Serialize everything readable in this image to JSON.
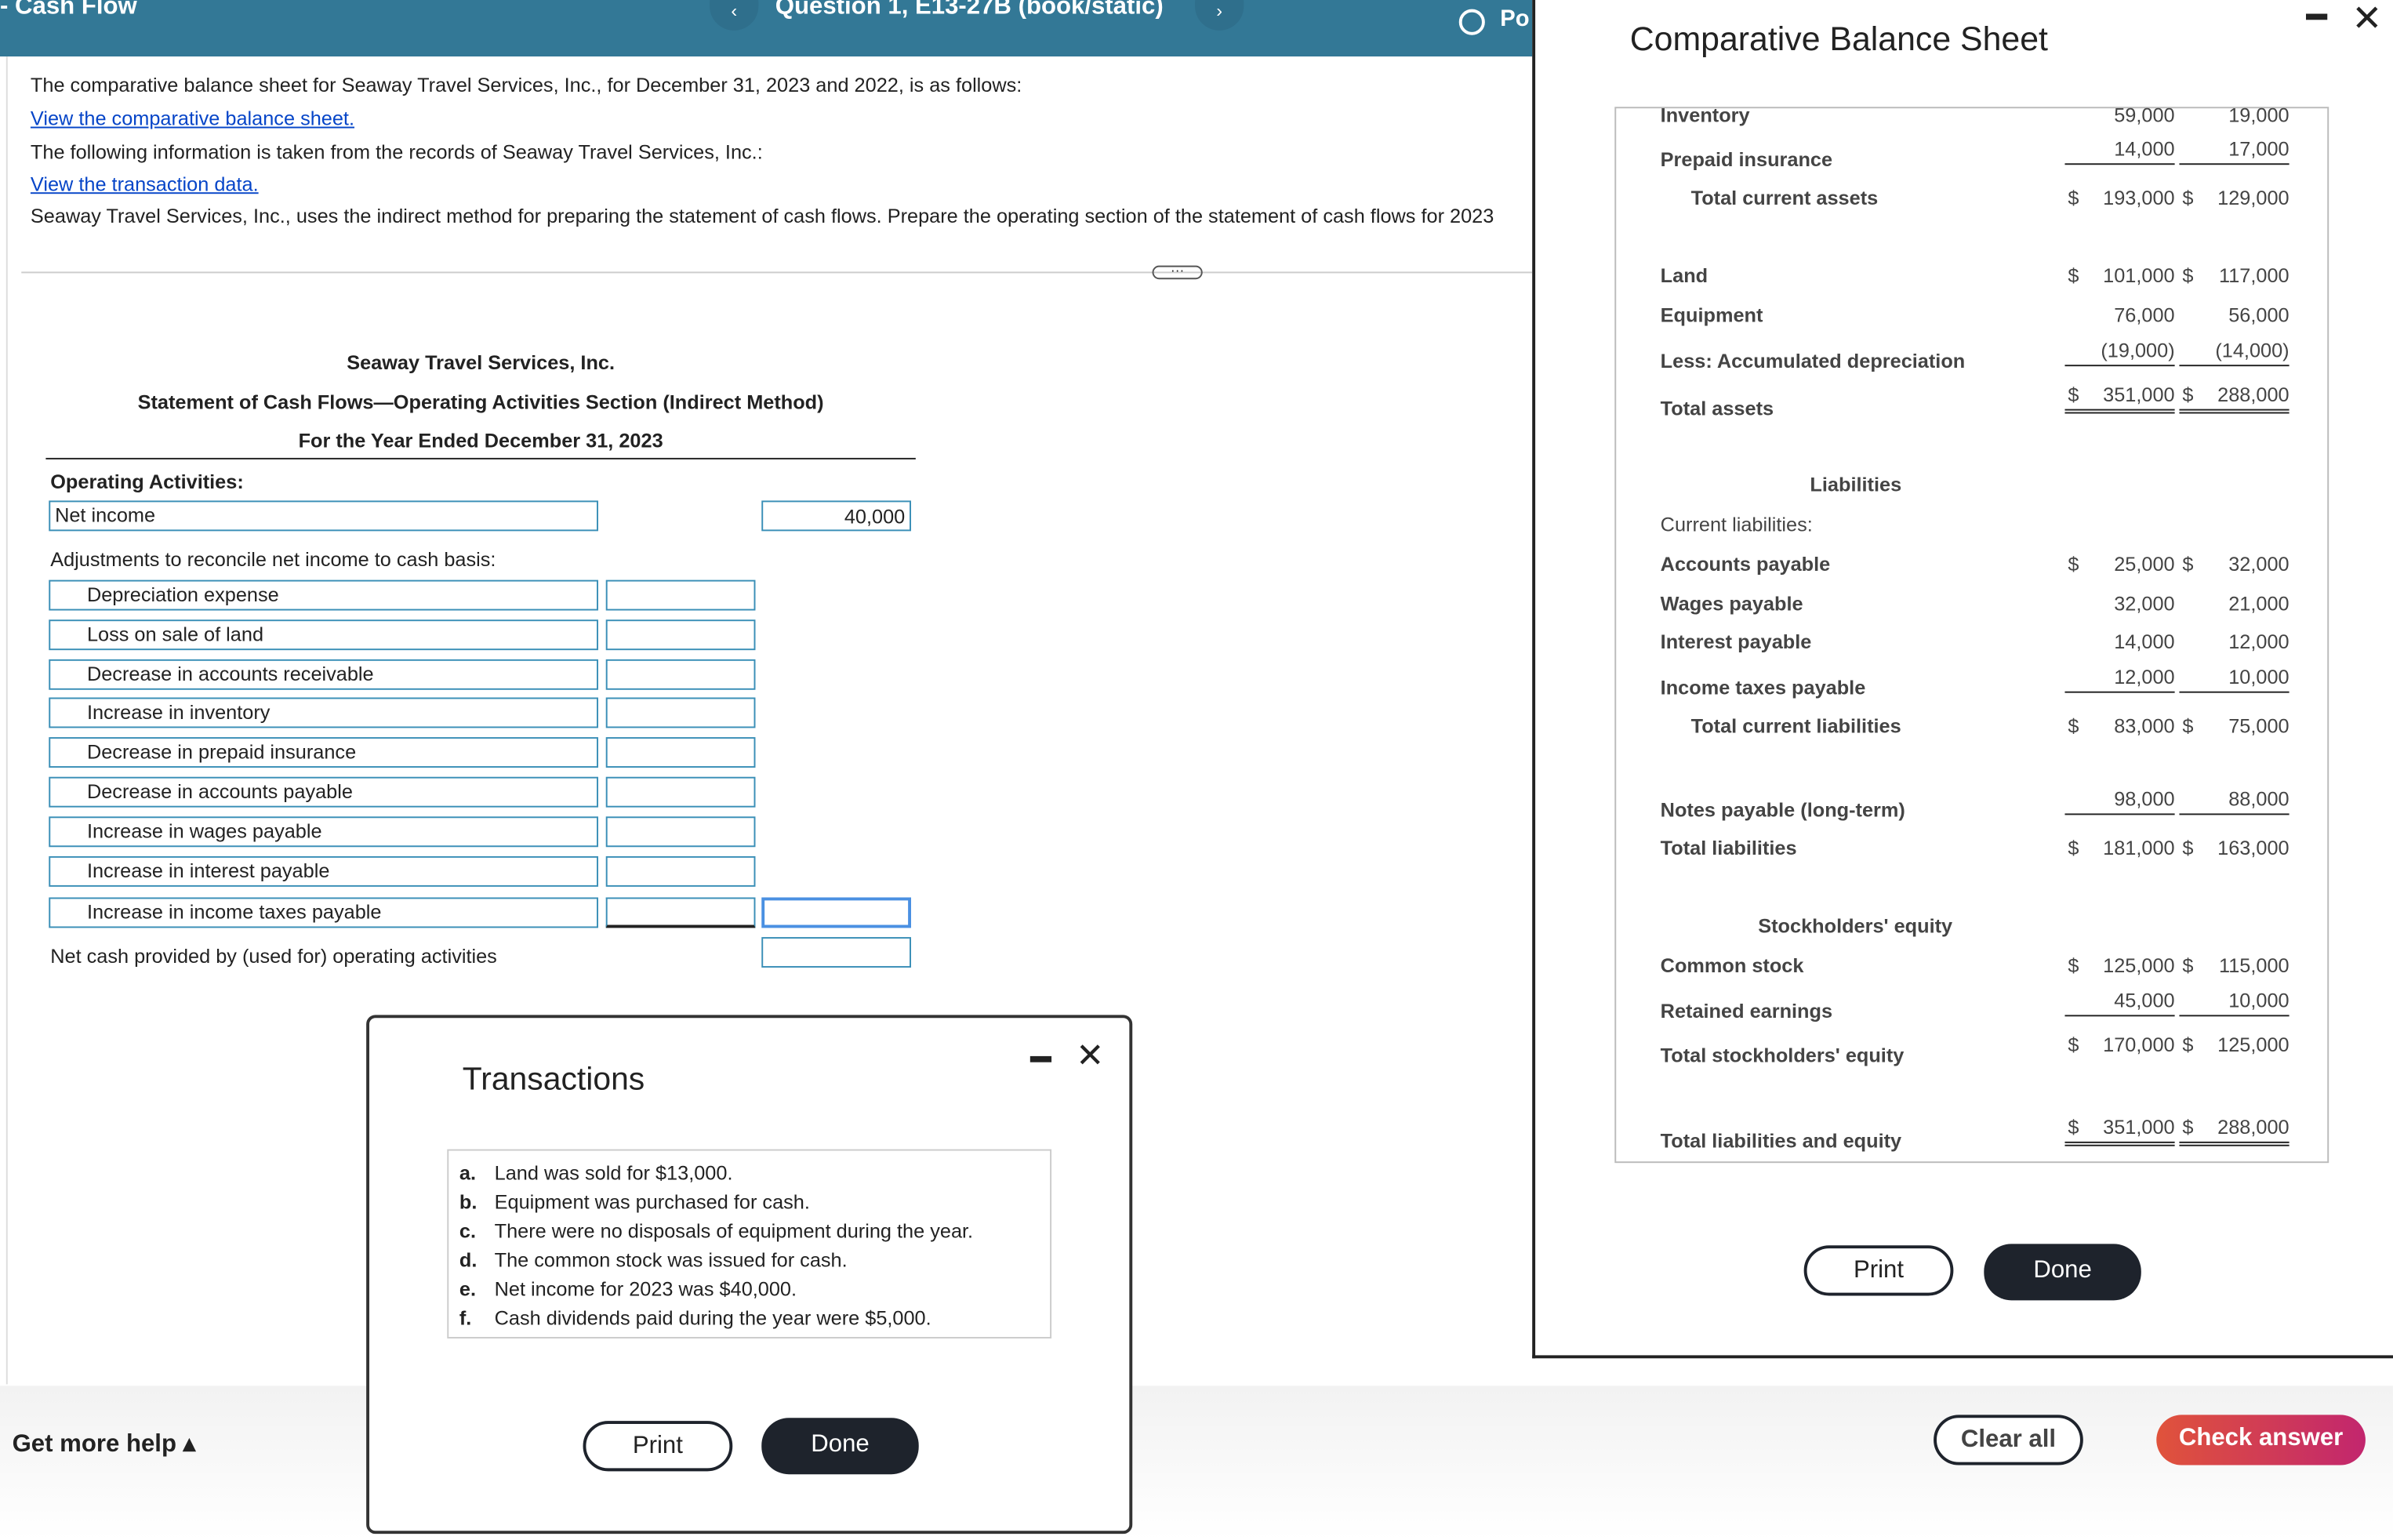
{
  "header": {
    "section": "- Cash Flow",
    "question": "Question 1, E13-27B (book/static)",
    "points": "Po",
    "prev_icon": "chevron-left-icon",
    "next_icon": "chevron-right-icon"
  },
  "prompt": {
    "line1": "The comparative balance sheet for Seaway Travel Services, Inc., for December 31, 2023 and 2022, is as follows:",
    "link1": "View the comparative balance sheet.",
    "line2": "The following information is taken from the records of Seaway Travel Services, Inc.:",
    "link2": "View the transaction data.",
    "line3": "Seaway Travel Services, Inc., uses the indirect method for preparing the statement of cash flows. Prepare the operating section of the statement of cash flows for 2023",
    "more": "···"
  },
  "statement": {
    "company": "Seaway Travel Services, Inc.",
    "title": "Statement of Cash Flows—Operating Activities Section (Indirect Method)",
    "period": "For the Year Ended December 31, 2023",
    "section": "Operating Activities:",
    "net_income_label": "Net income",
    "net_income_value": "40,000",
    "adjust_label": "Adjustments to reconcile net income to cash basis:",
    "adjustments": [
      "Depreciation expense",
      "Loss on sale of land",
      "Decrease in accounts receivable",
      "Increase in inventory",
      "Decrease in prepaid insurance",
      "Decrease in accounts payable",
      "Increase in wages payable",
      "Increase in interest payable",
      "Increase in income taxes payable"
    ],
    "net_cash_label": "Net cash provided by (used for) operating activities"
  },
  "balance_sheet": {
    "title": "Comparative Balance Sheet",
    "rows": [
      {
        "label": "Inventory",
        "a": "59,000",
        "b": "19,000"
      },
      {
        "label": "Prepaid insurance",
        "a": "14,000",
        "b": "17,000"
      },
      {
        "label": "Total current assets",
        "a": "193,000",
        "b": "129,000"
      },
      {
        "label": "Land",
        "a": "101,000",
        "b": "117,000"
      },
      {
        "label": "Equipment",
        "a": "76,000",
        "b": "56,000"
      },
      {
        "label": "Less: Accumulated depreciation",
        "a": "(19,000)",
        "b": "(14,000)"
      },
      {
        "label": "Total assets",
        "a": "351,000",
        "b": "288,000"
      },
      {
        "label": "Accounts payable",
        "a": "25,000",
        "b": "32,000"
      },
      {
        "label": "Wages payable",
        "a": "32,000",
        "b": "21,000"
      },
      {
        "label": "Interest payable",
        "a": "14,000",
        "b": "12,000"
      },
      {
        "label": "Income taxes payable",
        "a": "12,000",
        "b": "10,000"
      },
      {
        "label": "Total current liabilities",
        "a": "83,000",
        "b": "75,000"
      },
      {
        "label": "Notes payable (long-term)",
        "a": "98,000",
        "b": "88,000"
      },
      {
        "label": "Total liabilities",
        "a": "181,000",
        "b": "163,000"
      },
      {
        "label": "Common stock",
        "a": "125,000",
        "b": "115,000"
      },
      {
        "label": "Retained earnings",
        "a": "45,000",
        "b": "10,000"
      },
      {
        "label": "Total stockholders' equity",
        "a": "170,000",
        "b": "125,000"
      },
      {
        "label": "Total liabilities and equity",
        "a": "351,000",
        "b": "288,000"
      }
    ],
    "liabilities_heading": "Liabilities",
    "current_liabilities": "Current liabilities:",
    "equity_heading": "Stockholders' equity",
    "dollar": "$",
    "print": "Print",
    "done": "Done"
  },
  "transactions": {
    "title": "Transactions",
    "items": [
      {
        "k": "a.",
        "t": "Land was sold for $13,000."
      },
      {
        "k": "b.",
        "t": "Equipment was purchased for cash."
      },
      {
        "k": "c.",
        "t": "There were no disposals of equipment during the year."
      },
      {
        "k": "d.",
        "t": "The common stock was issued for cash."
      },
      {
        "k": "e.",
        "t": "Net income for 2023 was $40,000."
      },
      {
        "k": "f.",
        "t": "Cash dividends paid during the year were $5,000."
      }
    ],
    "print": "Print",
    "done": "Done"
  },
  "footer": {
    "help": "Get more help ▴",
    "clear": "Clear all",
    "check": "Check answer"
  },
  "colors": {
    "header": "#337896",
    "link": "#0645c8",
    "input_border": "#3a8fb7",
    "dark_button": "#1e232c",
    "check_gradient_start": "#e0533b",
    "check_gradient_end": "#c2266e"
  }
}
